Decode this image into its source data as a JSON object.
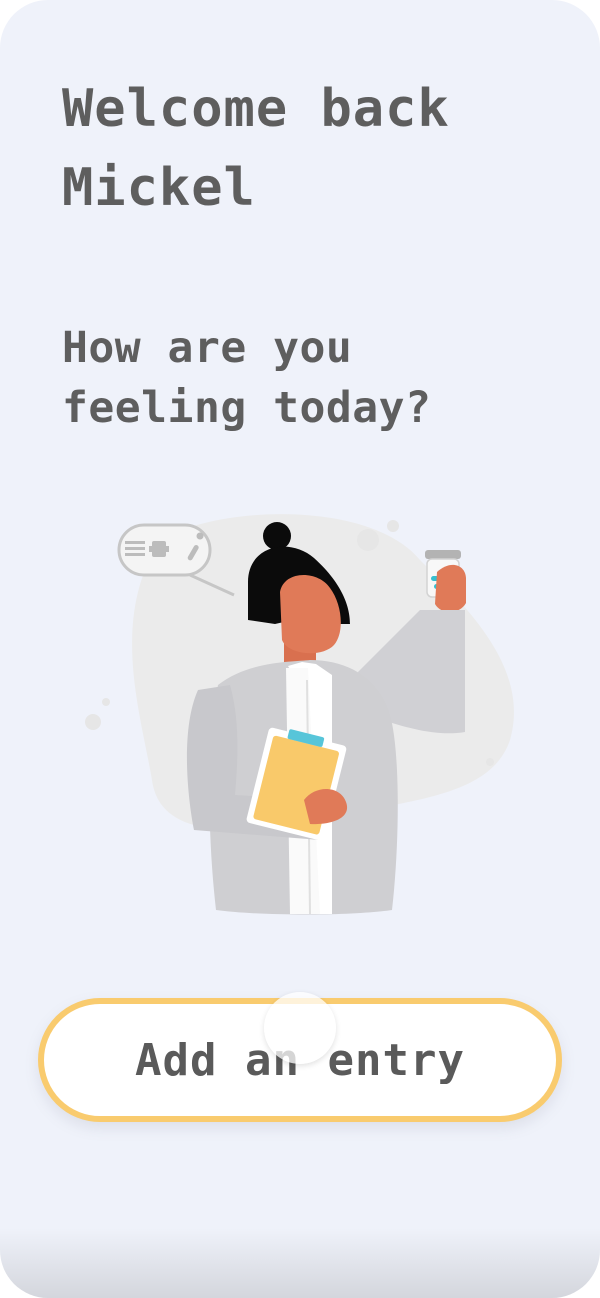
{
  "greeting": {
    "line1": "Welcome back",
    "line2": "Mickel"
  },
  "question": {
    "line1": "How are you",
    "line2": "feeling today?"
  },
  "illustration": {
    "subject": "woman-holding-pill-bottle-and-clipboard"
  },
  "primary_action": {
    "label": "Add an entry"
  },
  "colors": {
    "background": "#eff2fa",
    "text": "#5e5e5e",
    "button_border": "#f9cb6e",
    "button_fill": "#ffffff"
  }
}
